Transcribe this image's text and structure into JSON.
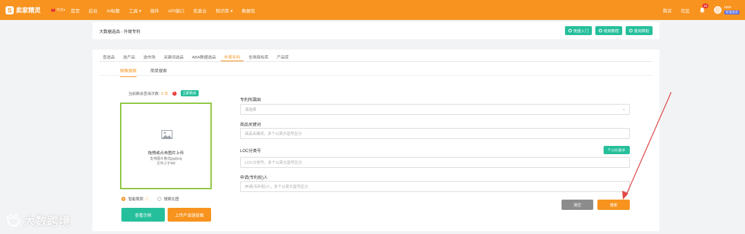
{
  "topbar": {
    "logo_glyph": "S",
    "logo_text": "卖家精灵",
    "lang": "中文",
    "nav": [
      "首页",
      "后台",
      "AI标题",
      "工具",
      "插件",
      "API接口",
      "优麦云",
      "知识库",
      "数据包"
    ],
    "nav_dropdown_marks": [
      "",
      "",
      "",
      "▾",
      "",
      "",
      "",
      "▾",
      ""
    ],
    "right_links": [
      "购买",
      "社区"
    ],
    "bell_count": "10",
    "username": "idvin",
    "user_badge": "标准会员"
  },
  "header": {
    "breadcrumb": "大数据选品 - 外观专利",
    "buttons": [
      "快速入门",
      "视频教程",
      "使用帮助"
    ]
  },
  "tabs": [
    "查选品",
    "选产品",
    "选市场",
    "关键词选品",
    "ABA数据选品",
    "外观专利",
    "全球商标库",
    "产品库"
  ],
  "active_tab_index": 5,
  "subtabs": [
    "图像搜索",
    "简单搜索"
  ],
  "quota": {
    "label": "当前剩余查询次数:",
    "count": "3 次",
    "warn_glyph": "!",
    "buy_label": "立即购买"
  },
  "upload": {
    "line1": "拖拽或点击图片上传",
    "line2": "支持图片格式jpg/png",
    "line3": "文件小于4M"
  },
  "radios": {
    "option1": "智能裁剪",
    "help_glyph": "ⓘ",
    "option2": "搜索比图"
  },
  "buttons": {
    "example": "查看示例",
    "upload_link": "上传产品链接图",
    "clear": "清空",
    "search": "搜索",
    "loc": "LOC助手"
  },
  "form": {
    "country_label": "专利所属国",
    "country_placeholder": "请选择",
    "keyword_label": "商品关键词",
    "keyword_placeholder": "商品关键词，多个以英文逗号区分",
    "loc_label": "LOC分类号",
    "loc_placeholder": "LOC分类号，多个以英文逗号区分",
    "applicant_label": "申请(专利权)人",
    "applicant_placeholder": "申请(专利权)人，多个以英文逗号区分"
  },
  "watermark": "大数跨境",
  "colors": {
    "brand_orange": "#f7931e",
    "teal": "#26bf9b",
    "upload_border": "#8dc63f",
    "arrow_red": "#e04a4a"
  }
}
